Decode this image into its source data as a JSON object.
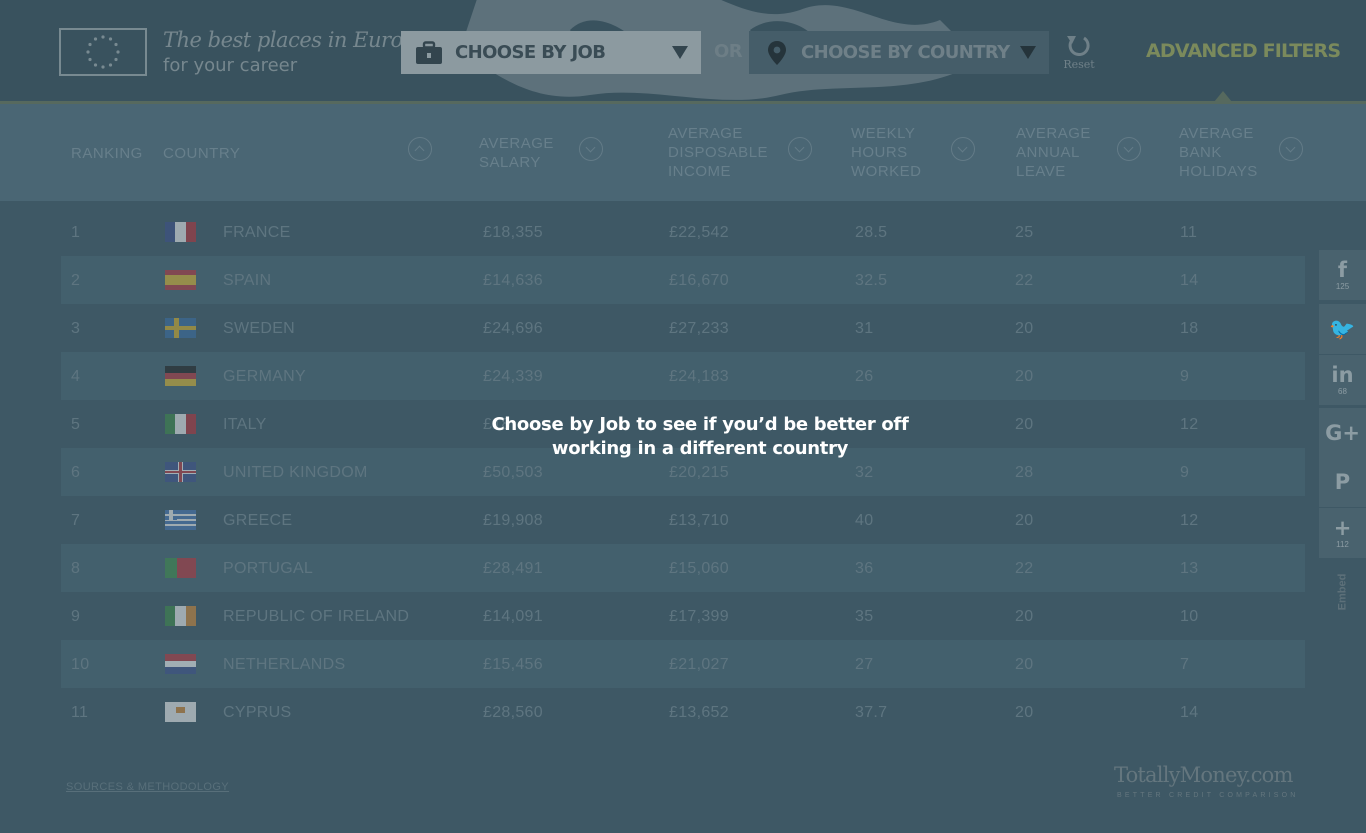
{
  "header": {
    "tagline_line1": "The best places in Europe",
    "tagline_line2": "for your career",
    "job_select_label": "CHOOSE BY JOB",
    "or_label": "OR",
    "country_select_label": "CHOOSE BY COUNTRY",
    "reset_label": "Reset",
    "advanced_filters_label": "ADVANCED FILTERS"
  },
  "columns": [
    {
      "label": "RANKING"
    },
    {
      "label": "COUNTRY"
    },
    {
      "label": "AVERAGE SALARY"
    },
    {
      "label": "AVERAGE DISPOSABLE INCOME"
    },
    {
      "label": "WEEKLY HOURS WORKED"
    },
    {
      "label": "AVERAGE ANNUAL LEAVE"
    },
    {
      "label": "AVERAGE BANK HOLIDAYS"
    }
  ],
  "columns_wrapped": {
    "salary": [
      "AVERAGE",
      "SALARY"
    ],
    "income": [
      "AVERAGE",
      "DISPOSABLE",
      "INCOME"
    ],
    "hours": [
      "WEEKLY",
      "HOURS",
      "WORKED"
    ],
    "leave": [
      "AVERAGE",
      "ANNUAL",
      "LEAVE"
    ],
    "holidays": [
      "AVERAGE",
      "BANK",
      "HOLIDAYS"
    ]
  },
  "rows": [
    {
      "rank": "1",
      "country": "FRANCE",
      "flag": "fr",
      "salary": "£18,355",
      "income": "£22,542",
      "hours": "28.5",
      "leave": "25",
      "holidays": "11"
    },
    {
      "rank": "2",
      "country": "SPAIN",
      "flag": "es",
      "salary": "£14,636",
      "income": "£16,670",
      "hours": "32.5",
      "leave": "22",
      "holidays": "14"
    },
    {
      "rank": "3",
      "country": "SWEDEN",
      "flag": "se",
      "salary": "£24,696",
      "income": "£27,233",
      "hours": "31",
      "leave": "20",
      "holidays": "18"
    },
    {
      "rank": "4",
      "country": "GERMANY",
      "flag": "de",
      "salary": "£24,339",
      "income": "£24,183",
      "hours": "26",
      "leave": "20",
      "holidays": "9"
    },
    {
      "rank": "5",
      "country": "ITALY",
      "flag": "it",
      "salary": "£18",
      "income": "",
      "hours": "",
      "leave": "20",
      "holidays": "12"
    },
    {
      "rank": "6",
      "country": "UNITED KINGDOM",
      "flag": "gb",
      "salary": "£50,503",
      "income": "£20,215",
      "hours": "32",
      "leave": "28",
      "holidays": "9"
    },
    {
      "rank": "7",
      "country": "GREECE",
      "flag": "gr",
      "salary": "£19,908",
      "income": "£13,710",
      "hours": "40",
      "leave": "20",
      "holidays": "12"
    },
    {
      "rank": "8",
      "country": "PORTUGAL",
      "flag": "pt",
      "salary": "£28,491",
      "income": "£15,060",
      "hours": "36",
      "leave": "22",
      "holidays": "13"
    },
    {
      "rank": "9",
      "country": "REPUBLIC OF IRELAND",
      "flag": "ie",
      "salary": "£14,091",
      "income": "£17,399",
      "hours": "35",
      "leave": "20",
      "holidays": "10"
    },
    {
      "rank": "10",
      "country": "NETHERLANDS",
      "flag": "nl",
      "salary": "£15,456",
      "income": "£21,027",
      "hours": "27",
      "leave": "20",
      "holidays": "7"
    },
    {
      "rank": "11",
      "country": "CYPRUS",
      "flag": "cy",
      "salary": "£28,560",
      "income": "£13,652",
      "hours": "37.7",
      "leave": "20",
      "holidays": "14"
    }
  ],
  "overlay_message": "Choose by Job to see if you’d be better off working in a different country",
  "footer": {
    "sources_label": "SOURCES & METHODOLOGY",
    "brand": "TotallyMoney.com",
    "brand_tagline": "BETTER CREDIT COMPARISON"
  },
  "share": [
    {
      "icon": "facebook-icon",
      "glyph": "f",
      "count": "125"
    },
    {
      "icon": "twitter-icon",
      "glyph": "🐦",
      "count": ""
    },
    {
      "icon": "linkedin-icon",
      "glyph": "in",
      "count": "68"
    },
    {
      "icon": "google-plus-icon",
      "glyph": "G+",
      "count": ""
    },
    {
      "icon": "pinterest-icon",
      "glyph": "P",
      "count": ""
    },
    {
      "icon": "more-share-icon",
      "glyph": "+",
      "count": "112"
    }
  ],
  "embed_label": "Embed",
  "colors": {
    "accent_filter": "#7b8a5c",
    "overlay_tint": "#3e5865"
  }
}
